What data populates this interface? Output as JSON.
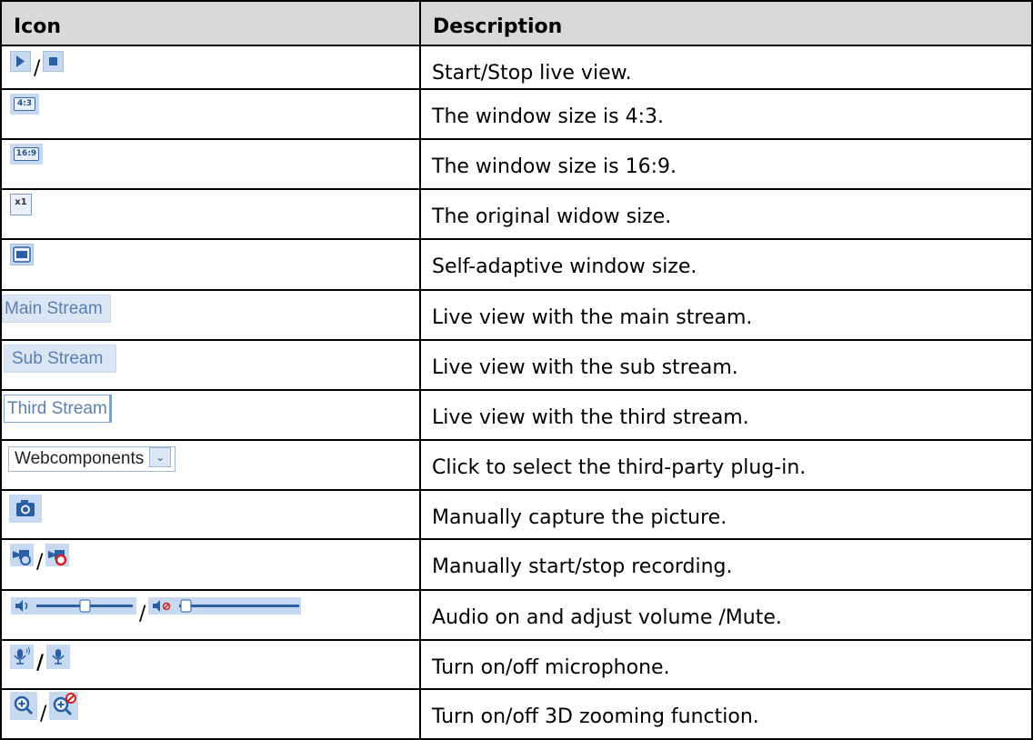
{
  "header": {
    "icon": "Icon",
    "description": "Description"
  },
  "separator": "/",
  "rows": [
    {
      "icons": [
        "play-icon",
        "stop-icon"
      ],
      "description": "Start/Stop live view."
    },
    {
      "icons": [
        "ratio-4-3-icon"
      ],
      "icon_text": "4:3",
      "description": "The window size is 4:3."
    },
    {
      "icons": [
        "ratio-16-9-icon"
      ],
      "icon_text": "16:9",
      "description": "The window size is 16:9."
    },
    {
      "icons": [
        "original-size-icon"
      ],
      "icon_text": "x1",
      "description": "The original widow size."
    },
    {
      "icons": [
        "self-adaptive-icon"
      ],
      "description": "Self-adaptive window size."
    },
    {
      "icons": [
        "main-stream-button"
      ],
      "icon_text": "Main Stream",
      "description": "Live view with the main stream."
    },
    {
      "icons": [
        "sub-stream-button"
      ],
      "icon_text": "Sub Stream",
      "description": "Live view with the sub stream."
    },
    {
      "icons": [
        "third-stream-button"
      ],
      "icon_text": "Third Stream",
      "description": "Live view with the third stream."
    },
    {
      "icons": [
        "plugin-select"
      ],
      "icon_text": "Webcomponents",
      "description": "Click to select the third-party plug-in."
    },
    {
      "icons": [
        "camera-icon"
      ],
      "description": "Manually capture the picture."
    },
    {
      "icons": [
        "record-start-icon",
        "record-stop-icon"
      ],
      "description": "Manually start/stop recording."
    },
    {
      "icons": [
        "audio-on-volume-icon",
        "mute-icon"
      ],
      "description": "Audio on and adjust volume /Mute."
    },
    {
      "icons": [
        "microphone-on-icon",
        "microphone-off-icon"
      ],
      "description": "Turn on/off microphone."
    },
    {
      "icons": [
        "zoom-3d-on-icon",
        "zoom-3d-off-icon"
      ],
      "description": "Turn on/off 3D zooming function."
    }
  ]
}
